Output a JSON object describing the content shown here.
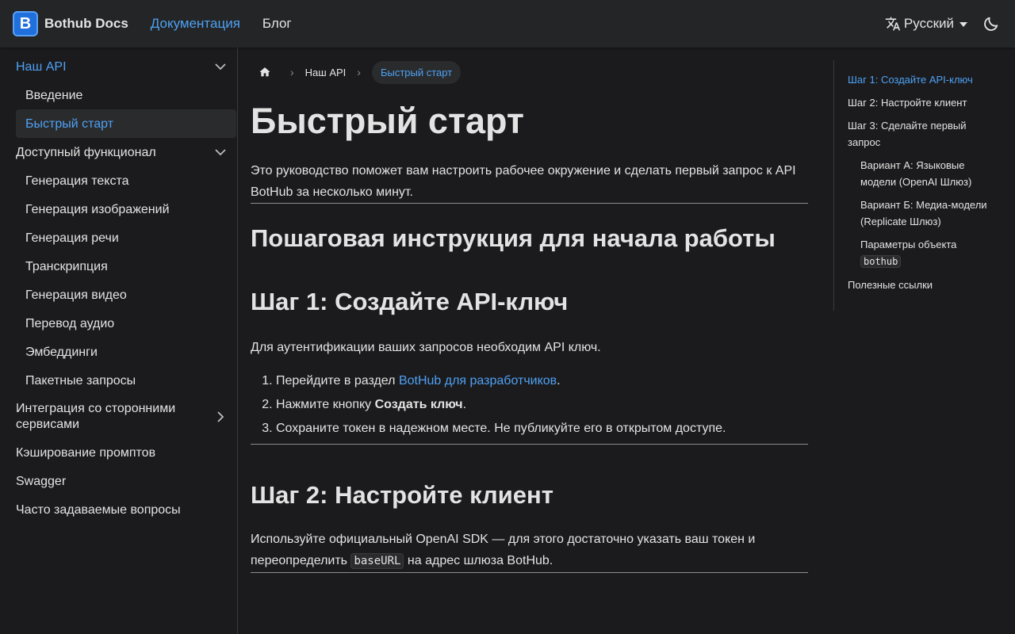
{
  "navbar": {
    "logo_letter": "B",
    "brand": "Bothub Docs",
    "links": [
      "Документация",
      "Блог"
    ],
    "language": "Русский",
    "theme_icon": "moon-icon",
    "colors": {
      "accent": "#4ea1f3",
      "background": "#1b1b1d",
      "navbar": "#242526"
    }
  },
  "sidebar": {
    "items": [
      {
        "label": "Наш API"
      },
      {
        "label": "Введение"
      },
      {
        "label": "Быстрый старт"
      },
      {
        "label": "Доступный функционал"
      },
      {
        "label": "Генерация текста"
      },
      {
        "label": "Генерация изображений"
      },
      {
        "label": "Генерация речи"
      },
      {
        "label": "Транскрипция"
      },
      {
        "label": "Генерация видео"
      },
      {
        "label": "Перевод аудио"
      },
      {
        "label": "Эмбеддинги"
      },
      {
        "label": "Пакетные запросы"
      },
      {
        "label": "Интеграция со сторонними сервисами"
      },
      {
        "label": "Кэширование промптов"
      },
      {
        "label": "Swagger"
      },
      {
        "label": "Часто задаваемые вопросы"
      }
    ]
  },
  "breadcrumbs": {
    "home_icon": "home-icon",
    "items": [
      "Наш API",
      "Быстрый старт"
    ]
  },
  "main": {
    "title": "Быстрый старт",
    "intro": "Это руководство поможет вам настроить рабочее окружение и сделать первый запрос к API BotHub за несколько минут.",
    "section_title": "Пошаговая инструкция для начала работы",
    "step1": {
      "title": "Шаг 1: Создайте API-ключ",
      "text": "Для аутентификации ваших запросов необходим API ключ.",
      "item1_prefix": "Перейдите в раздел ",
      "item1_link": "BotHub для разработчиков",
      "item1_suffix": ".",
      "item2_prefix": "Нажмите кнопку ",
      "item2_bold": "Создать ключ",
      "item2_suffix": ".",
      "item3": "Сохраните токен в надежном месте. Не публикуйте его в открытом доступе."
    },
    "step2": {
      "title": "Шаг 2: Настройте клиент",
      "text_before": "Используйте официальный OpenAI SDK — для этого достаточно указать ваш токен и переопределить ",
      "code": "baseURL",
      "text_after": " на адрес шлюза BotHub."
    }
  },
  "toc": {
    "items": [
      "Шаг 1: Создайте API-ключ",
      "Шаг 2: Настройте клиент",
      "Шаг 3: Сделайте первый запрос",
      "Вариант А: Языковые модели (OpenAI Шлюз)",
      "Вариант Б: Медиа-модели (Replicate Шлюз)",
      "Параметры объекта ",
      "Полезные ссылки"
    ],
    "code": "bothub"
  }
}
